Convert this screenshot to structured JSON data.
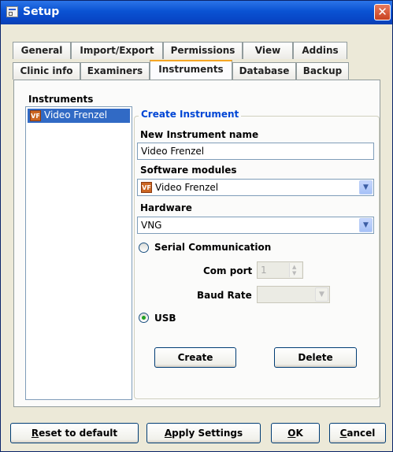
{
  "window": {
    "title": "Setup"
  },
  "tabs": {
    "row1": [
      "General",
      "Import/Export",
      "Permissions",
      "View",
      "Addins"
    ],
    "row2": [
      "Clinic info",
      "Examiners",
      "Instruments",
      "Database",
      "Backup"
    ],
    "active": "Instruments"
  },
  "instruments_list": {
    "label": "Instruments",
    "items": [
      {
        "icon": "VF",
        "label": "Video Frenzel",
        "selected": true
      }
    ]
  },
  "create_group": {
    "title": "Create Instrument",
    "name_label": "New Instrument name",
    "name_value": "Video Frenzel",
    "modules_label": "Software modules",
    "modules_icon": "VF",
    "modules_value": "Video Frenzel",
    "hardware_label": "Hardware",
    "hardware_value": "VNG",
    "serial_label": "Serial Communication",
    "serial_selected": false,
    "com_port_label": "Com port",
    "com_port_value": "1",
    "baud_rate_label": "Baud Rate",
    "baud_rate_value": "",
    "usb_label": "USB",
    "usb_selected": true,
    "create_button": "Create",
    "delete_button": "Delete"
  },
  "footer": {
    "reset_first": "R",
    "reset_rest": "eset to default",
    "apply_first": "A",
    "apply_rest": "pply Settings",
    "ok_first": "O",
    "ok_rest": "K",
    "cancel_first": "C",
    "cancel_rest": "ancel"
  },
  "colors": {
    "titlebar": "#0a52d2",
    "active_tab_accent": "#f5a623",
    "selection": "#316ac5",
    "group_title": "#0046d5"
  }
}
